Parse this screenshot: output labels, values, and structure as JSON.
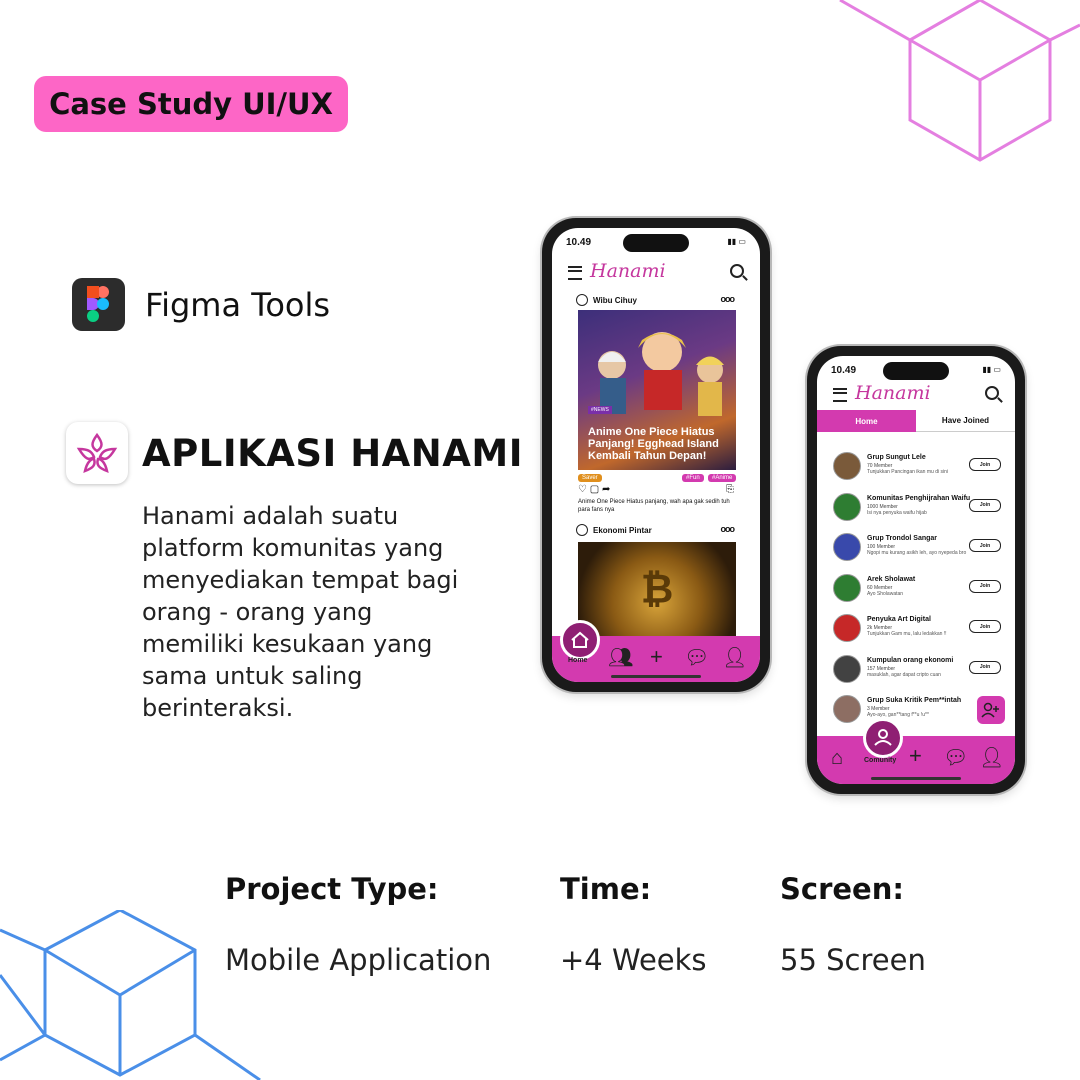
{
  "badge": {
    "label": "Case Study UI/UX",
    "color": "#fd66c6"
  },
  "tool": {
    "icon": "figma-icon",
    "label": "Figma Tools"
  },
  "app": {
    "icon": "sakura-icon",
    "title": "APLIKASI HANAMI",
    "description": "Hanami adalah suatu platform komunitas yang menyediakan tempat bagi orang - orang yang memiliki kesukaan yang sama untuk saling berinteraksi."
  },
  "facts": [
    {
      "heading": "Project Type:",
      "value": "Mobile Application"
    },
    {
      "heading": "Time:",
      "value": "+4 Weeks"
    },
    {
      "heading": "Screen:",
      "value": "55 Screen"
    }
  ],
  "colors": {
    "accent": "#d33aaf",
    "pink_deco": "#e47fe0",
    "blue_deco": "#4a8fe8"
  },
  "phone1": {
    "time": "10.49",
    "logo": "Hanami",
    "posts": [
      {
        "author": "Wibu Cihuy",
        "tag": "#NEWS",
        "headline": "Anime One Piece Hiatus Panjang! Egghead Island Kembali Tahun Depan!",
        "chips": [
          "Saver",
          "#Fun",
          "#Anime"
        ],
        "caption": "Anime One Piece Hiatus panjang, wah apa gak sedih tuh para fans nya"
      },
      {
        "author": "Ekonomi Pintar"
      }
    ],
    "nav_active_label": "Home"
  },
  "phone2": {
    "time": "10.49",
    "logo": "Hanami",
    "tabs": [
      "Home",
      "Have Joined"
    ],
    "join_label": "Join",
    "groups": [
      {
        "name": "Grup Sungut Lele",
        "members": "70 Member",
        "desc": "Tunjukkan Pancingan ikan mu di sini"
      },
      {
        "name": "Komunitas Penghijrahan Waifu",
        "members": "1000 Member",
        "desc": "Isi nya penyuka waifu hijab"
      },
      {
        "name": "Grup Trondol Sangar",
        "members": "100 Member",
        "desc": "Ngopi mu kurang asikh leh, ayo nyepeda bro"
      },
      {
        "name": "Arek Sholawat",
        "members": "60 Member",
        "desc": "Ayo Sholawatan"
      },
      {
        "name": "Penyuka Art Digital",
        "members": "2k Member",
        "desc": "Tunjukkan Gam mu, lalu ledakkan !!"
      },
      {
        "name": "Kumpulan orang ekonomi",
        "members": "157 Member",
        "desc": "masuklah, agar dapat cripto cuan"
      },
      {
        "name": "Grup Suka Kritik Pem**intah",
        "members": "3 Member",
        "desc": "Ayo-ayo, gan**tang f**u !u**"
      }
    ],
    "nav_active_label": "Comunity"
  }
}
